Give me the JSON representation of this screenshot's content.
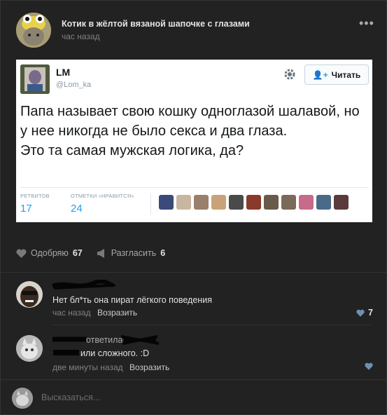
{
  "post": {
    "title": "Котик в жёлтой вязаной шапочке с глазами",
    "time": "час назад",
    "more_icon": "more-dots-icon"
  },
  "tweet": {
    "name": "LM",
    "handle": "@Lom_ka",
    "follow_label": "Читать",
    "text": "Папа называет свою кошку одноглазой шалавой, но у нее никогда не было секса и два глаза.\nЭто та самая мужская логика, да?",
    "retweets_label": "РЕТВИТОВ",
    "retweets": "17",
    "likes_label": "ОТМЕТКИ «НРАВИТСЯ»",
    "likes": "24",
    "likers_colors": [
      "#3a4a7a",
      "#c8b6a0",
      "#9a7f6a",
      "#c9a27a",
      "#4a4a4a",
      "#8a3a2a",
      "#6a5a4a",
      "#7a6a5a",
      "#c86a8a",
      "#4a6a8a",
      "#5a3a3a"
    ]
  },
  "actions": {
    "like_label": "Одобряю",
    "like_count": "67",
    "share_label": "Разгласить",
    "share_count": "6"
  },
  "comments": [
    {
      "text": "Нет бл*ть она пират лёгкого поведения",
      "time": "час назад",
      "reply_label": "Возразить",
      "likes": "7"
    },
    {
      "reply_to": "ответила",
      "text": "или сложного. :D",
      "time": "две минуты назад",
      "reply_label": "Возразить"
    }
  ],
  "composer": {
    "placeholder": "Высказаться..."
  },
  "colors": {
    "background": "#222222",
    "twitter_blue": "#1da1f2",
    "meta_gray": "#828282"
  }
}
